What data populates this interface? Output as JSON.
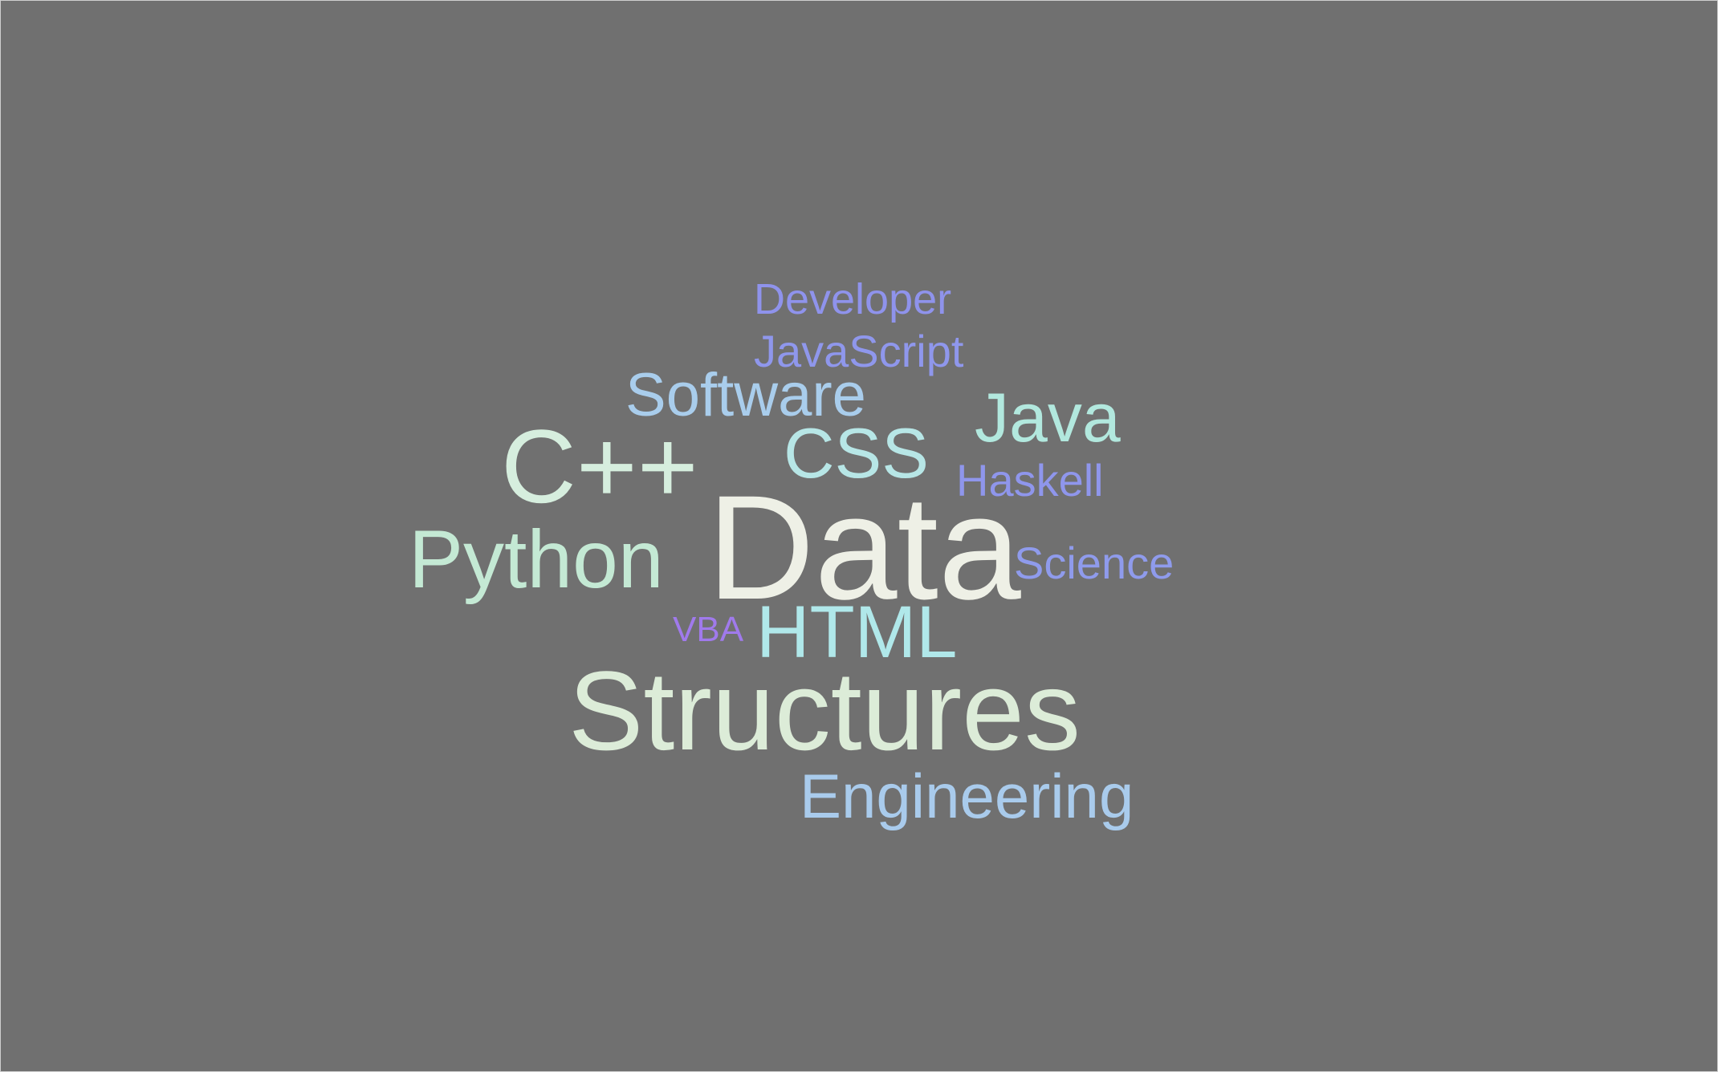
{
  "words": [
    {
      "key": "developer",
      "text": "Developer",
      "color": "#8f93ec"
    },
    {
      "key": "javascript",
      "text": "JavaScript",
      "color": "#8f97ec"
    },
    {
      "key": "software",
      "text": "Software",
      "color": "#a9cdec"
    },
    {
      "key": "java",
      "text": "Java",
      "color": "#b2e8de"
    },
    {
      "key": "cpp",
      "text": "C++",
      "color": "#d6eede"
    },
    {
      "key": "css",
      "text": "CSS",
      "color": "#b7e6e6"
    },
    {
      "key": "haskell",
      "text": "Haskell",
      "color": "#8f96ec"
    },
    {
      "key": "data",
      "text": "Data",
      "color": "#eef0e6"
    },
    {
      "key": "python",
      "text": "Python",
      "color": "#c4e9d4"
    },
    {
      "key": "science",
      "text": "Science",
      "color": "#8f9bec"
    },
    {
      "key": "vba",
      "text": "VBA",
      "color": "#a07aec"
    },
    {
      "key": "html",
      "text": "HTML",
      "color": "#b0e8ea"
    },
    {
      "key": "structures",
      "text": "Structures",
      "color": "#dcecd8"
    },
    {
      "key": "engineering",
      "text": "Engineering",
      "color": "#a9cbec"
    }
  ],
  "background_color": "#707070"
}
